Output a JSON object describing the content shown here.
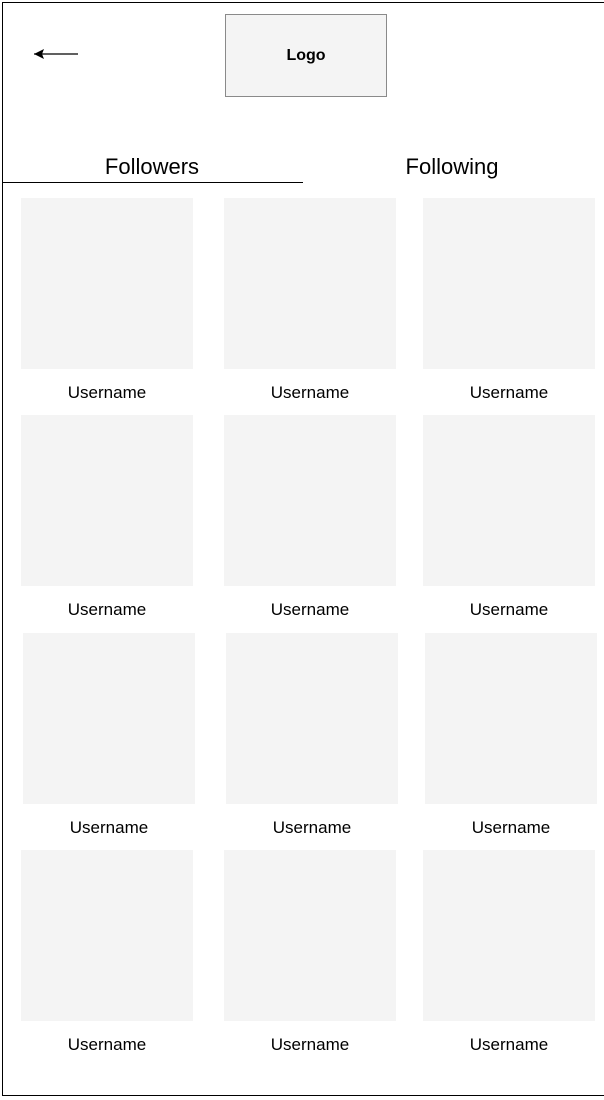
{
  "header": {
    "back_label": "",
    "logo_label": "Logo"
  },
  "tabs": [
    {
      "label": "Followers",
      "active": true
    },
    {
      "label": "Following",
      "active": false
    }
  ],
  "users": [
    {
      "username": "Username"
    },
    {
      "username": "Username"
    },
    {
      "username": "Username"
    },
    {
      "username": "Username"
    },
    {
      "username": "Username"
    },
    {
      "username": "Username"
    },
    {
      "username": "Username"
    },
    {
      "username": "Username"
    },
    {
      "username": "Username"
    },
    {
      "username": "Username"
    },
    {
      "username": "Username"
    },
    {
      "username": "Username"
    }
  ],
  "colors": {
    "placeholder": "#f4f4f4",
    "logo_border": "#8a8a8a",
    "line": "#000000"
  }
}
